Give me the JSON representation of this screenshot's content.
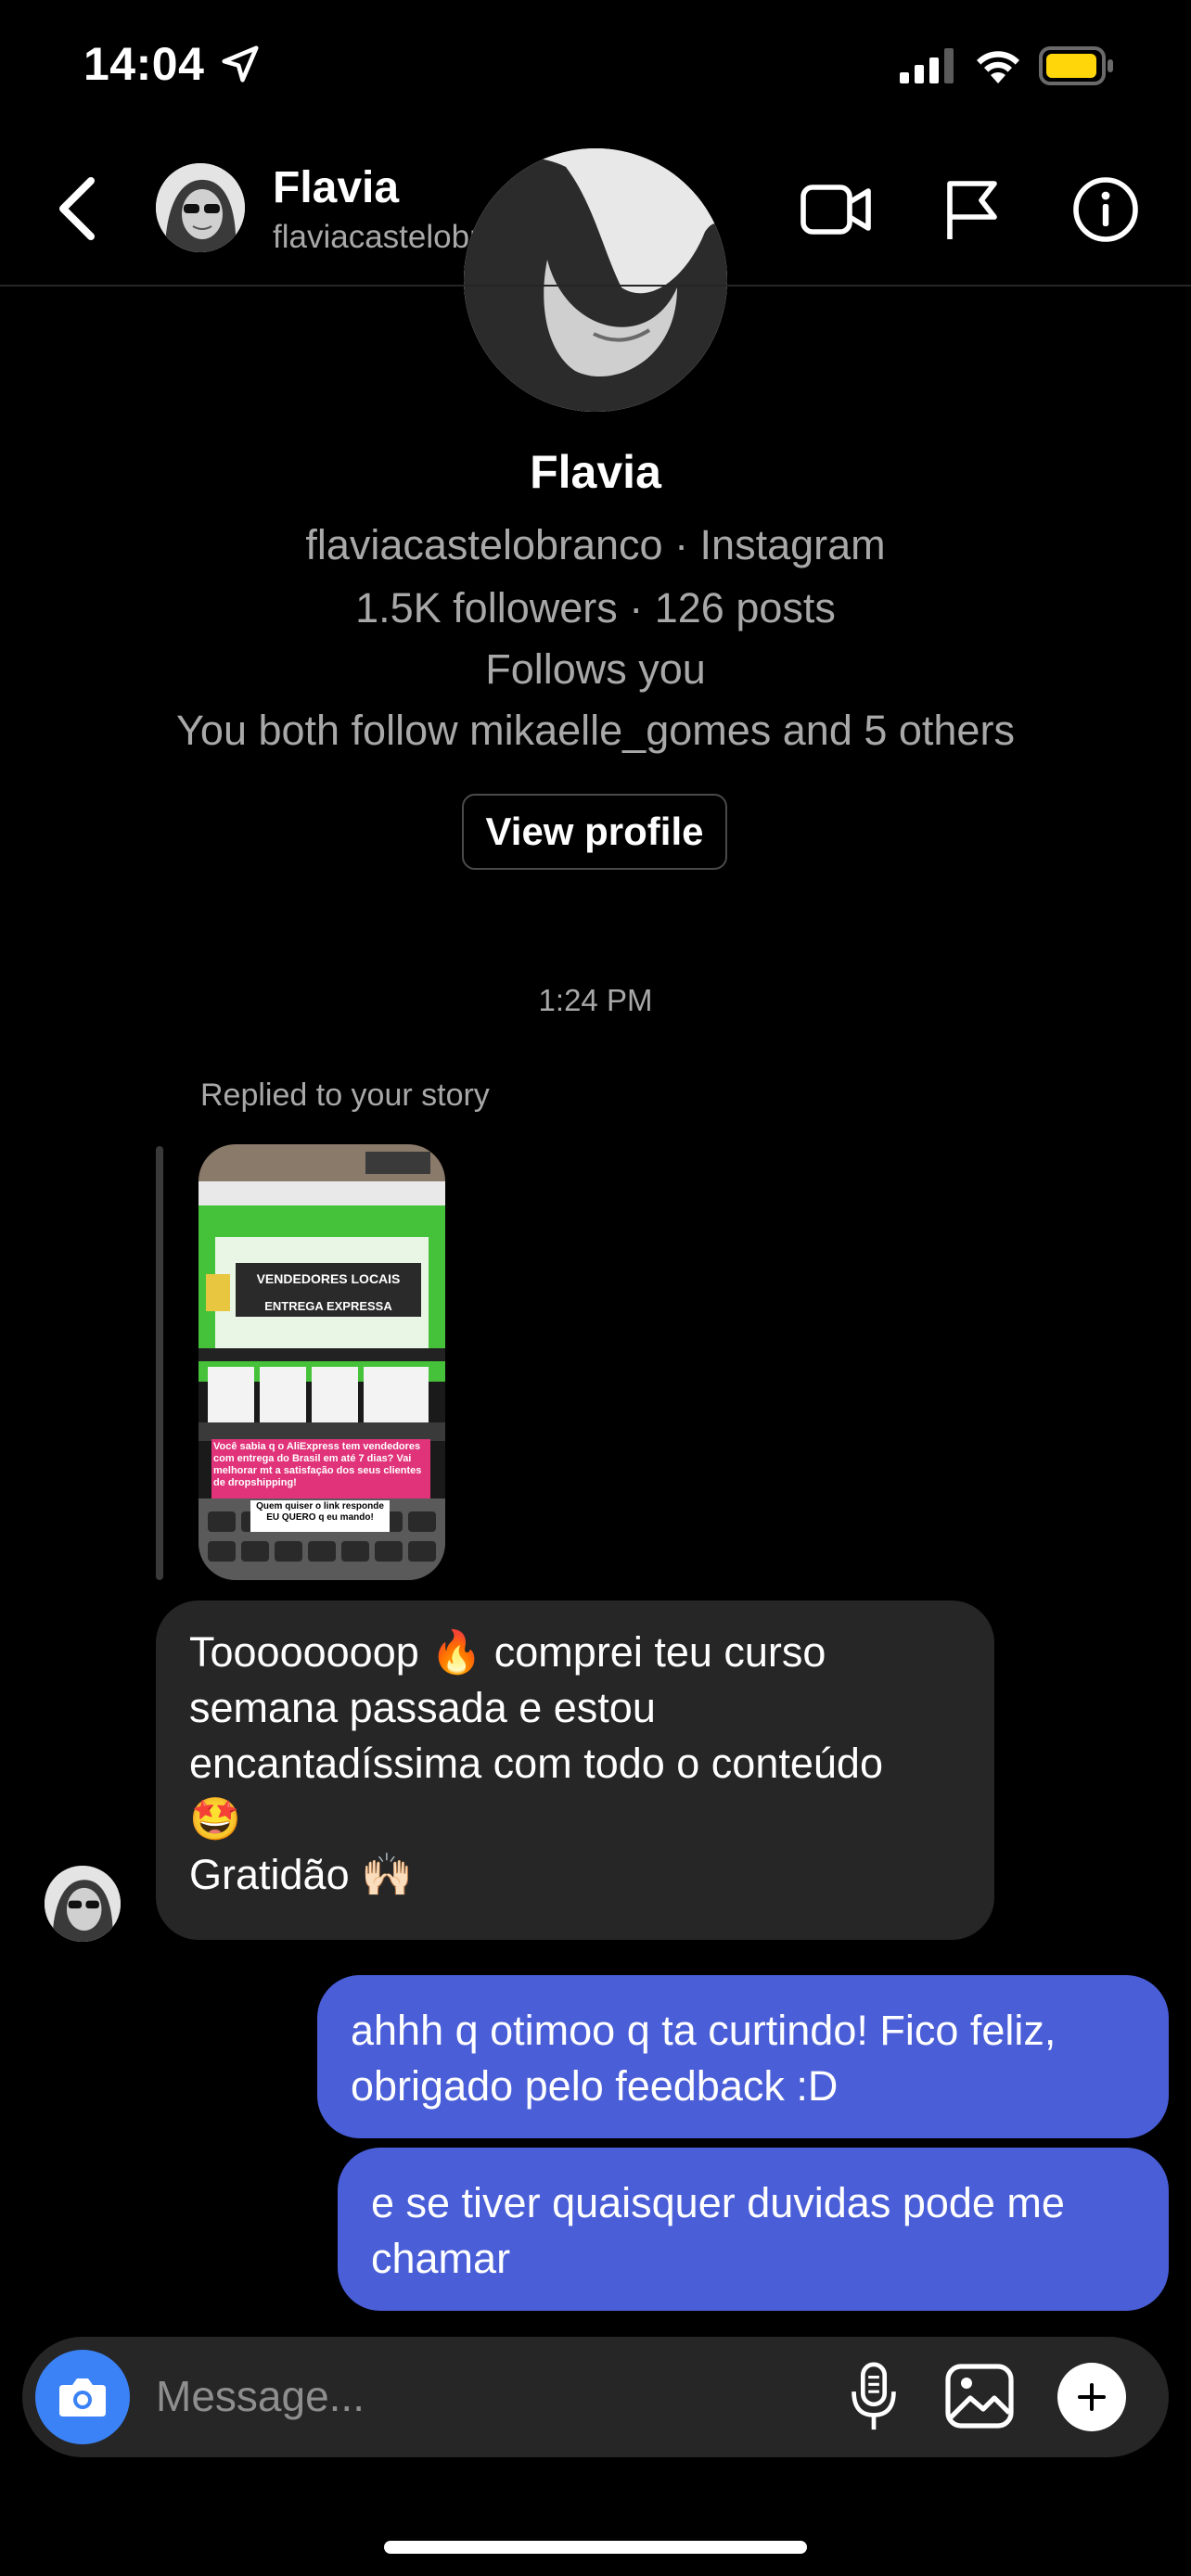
{
  "status_bar": {
    "time": "14:04",
    "icons": [
      "location-arrow-icon",
      "signal-icon",
      "wifi-icon",
      "battery-icon"
    ]
  },
  "header": {
    "name": "Flavia",
    "username": "flaviacastelobranco",
    "icons": [
      "back-icon",
      "video-call-icon",
      "flag-icon",
      "info-icon"
    ]
  },
  "profile_card": {
    "name": "Flavia",
    "handle_line": "flaviacastelobranco · Instagram",
    "stats_line": "1.5K followers · 126 posts",
    "follows_line": "Follows you",
    "mutuals_line": "You both follow mikaelle_gomes and 5 others",
    "view_profile_label": "View profile"
  },
  "thread": {
    "timestamp": "1:24 PM",
    "story_reply_label": "Replied to your story",
    "story": {
      "banner_line1": "VENDEDORES LOCAIS",
      "banner_line2": "ENTREGA EXPRESSA",
      "caption_pink": "Você sabia q o AliExpress tem vendedores com entrega do Brasil em até 7 dias? Vai melhorar mt a satisfação dos seus clientes de dropshipping!",
      "caption_white": "Quem quiser o link responde EU QUERO q eu mando!"
    },
    "incoming": {
      "line1": "Toooooooop 🔥 comprei teu curso",
      "line2": "semana passada e estou",
      "line3": "encantadíssima com todo o conteúdo",
      "line4": "🤩",
      "line5": "Gratidão 🙌🏻"
    },
    "outgoing": [
      {
        "line1": "ahhh q otimoo q ta curtindo! Fico feliz,",
        "line2": "obrigado pelo feedback :D"
      },
      {
        "line1": "e se tiver quaisquer duvidas pode me",
        "line2": "chamar"
      }
    ]
  },
  "composer": {
    "placeholder": "Message...",
    "icons": [
      "camera-icon",
      "microphone-icon",
      "gallery-icon",
      "plus-icon"
    ]
  },
  "colors": {
    "background": "#000000",
    "incoming_bubble": "#262626",
    "outgoing_bubble": "#4a5ed8",
    "camera_button": "#3b82f6",
    "secondary_text": "#a8a8a8",
    "battery": "#ffd60a"
  }
}
